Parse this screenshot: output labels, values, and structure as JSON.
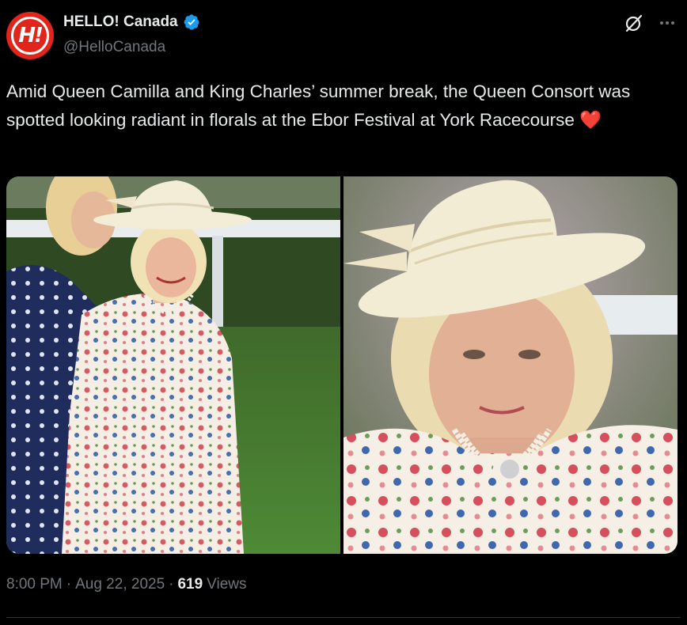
{
  "account": {
    "avatar_text": "H!",
    "display_name": "HELLO! Canada",
    "handle": "@HelloCanada",
    "verified": true
  },
  "tweet": {
    "text": "Amid Queen Camilla and King Charles’ summer break, the Queen Consort was spotted looking radiant in florals at the Ebor Festival at York Racecourse",
    "emoji": "❤️"
  },
  "meta": {
    "time": "8:00 PM",
    "separator_1": "·",
    "date": "Aug 22, 2025",
    "separator_2": "·",
    "views_count": "619",
    "views_label": "Views"
  },
  "icons": {
    "grok": "grok-icon",
    "more": "more-options-icon",
    "verified": "verified-badge-icon"
  },
  "colors": {
    "background": "#000000",
    "text": "#e7e9ea",
    "muted": "#71767b",
    "verified": "#1d9bf0",
    "brand": "#e1251b",
    "heart": "#f91880"
  }
}
